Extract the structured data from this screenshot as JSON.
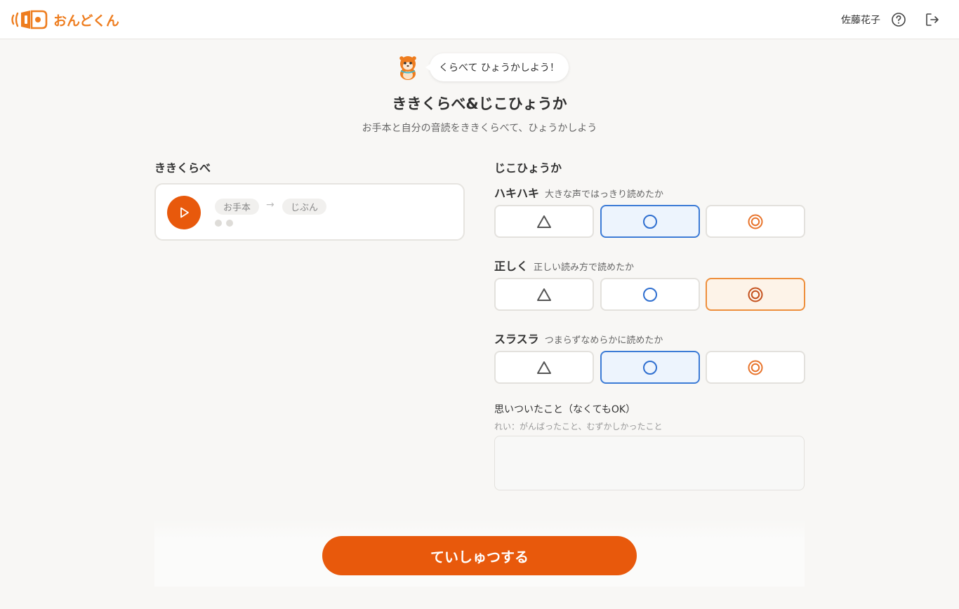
{
  "header": {
    "app_name": "おんどくん",
    "user_name": "佐藤花子",
    "brand_color": "#ee7d1f"
  },
  "mascot": {
    "bubble": "くらべて ひょうかしよう！"
  },
  "page": {
    "title": "ききくらべ&じこひょうか",
    "subtitle": "お手本と自分の音読をききくらべて、ひょうかしよう"
  },
  "compare": {
    "title": "ききくらべ",
    "model_label": "お手本",
    "arrow": "→",
    "self_label": "じぶん"
  },
  "evaluation": {
    "title": "じこひょうか",
    "criteria": [
      {
        "name": "ハキハキ",
        "desc": "大きな声ではっきり読めたか",
        "selected": "circle"
      },
      {
        "name": "正しく",
        "desc": "正しい読み方で読めたか",
        "selected": "double-circle"
      },
      {
        "name": "スラスラ",
        "desc": "つまらずなめらかに読めたか",
        "selected": "circle"
      }
    ],
    "options": [
      "triangle",
      "circle",
      "double-circle"
    ]
  },
  "notes": {
    "label": "思いついたこと（なくてもOK）",
    "hint": "れい：がんばったこと、むずかしかったこと",
    "value": ""
  },
  "submit": {
    "label": "ていしゅつする",
    "color": "#e8590c"
  }
}
